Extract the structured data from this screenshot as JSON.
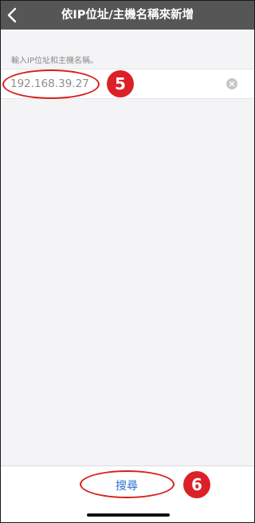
{
  "header": {
    "title": "依IP位址/主機名稱來新增",
    "back_icon": "chevron-left-icon"
  },
  "form": {
    "label": "輸入IP位址和主機名稱。",
    "ip_value": "192.168.39.27",
    "clear_icon": "clear-circle-icon"
  },
  "footer": {
    "search_label": "搜尋"
  },
  "annotations": {
    "step5": "5",
    "step6": "6",
    "color": "#d81e1e"
  },
  "colors": {
    "nav_background": "#565656",
    "accent": "#2a6fd1",
    "badge": "#db2127"
  }
}
